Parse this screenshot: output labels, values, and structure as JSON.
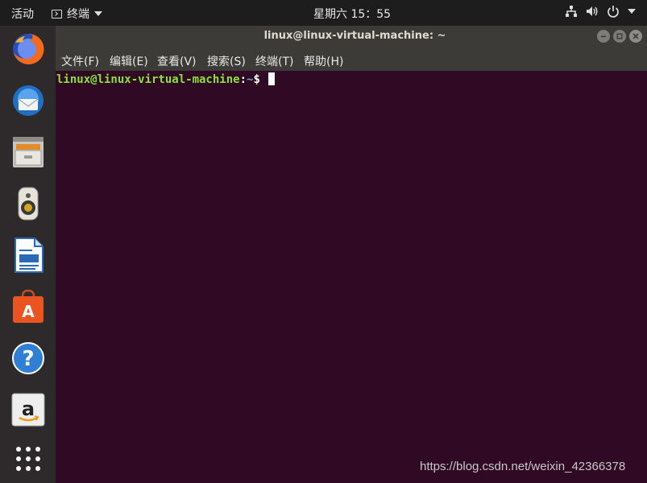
{
  "topbar": {
    "activities": "活动",
    "app_name": "终端",
    "clock": "星期六 15：55"
  },
  "dock": {
    "items": [
      {
        "name": "firefox-icon"
      },
      {
        "name": "thunderbird-icon"
      },
      {
        "name": "files-icon"
      },
      {
        "name": "rhythmbox-icon"
      },
      {
        "name": "libreoffice-writer-icon"
      },
      {
        "name": "ubuntu-software-icon"
      },
      {
        "name": "help-icon"
      },
      {
        "name": "amazon-icon"
      },
      {
        "name": "show-apps-icon"
      }
    ]
  },
  "window": {
    "title": "linux@linux-virtual-machine: ~",
    "menu": [
      "文件(F)",
      "编辑(E)",
      "查看(V)",
      "搜索(S)",
      "终端(T)",
      "帮助(H)"
    ]
  },
  "terminal": {
    "user_host": "linux@linux-virtual-machine",
    "sep": ":",
    "path": "~",
    "sign": "$ "
  },
  "watermark": "https://blog.csdn.net/weixin_42366378",
  "colors": {
    "terminal_bg": "#300a24",
    "prompt_user": "#8ae234",
    "prompt_path": "#729fcf",
    "topbar_bg": "#1d1d1d",
    "dock_bg": "#2e2a2c",
    "titlebar_bg": "#3c3b37"
  }
}
